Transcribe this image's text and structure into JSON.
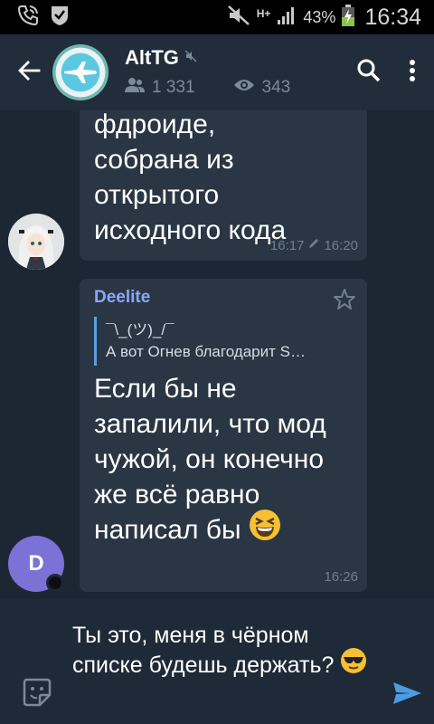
{
  "status_bar": {
    "signal_type": "H+",
    "battery_percent": "43%",
    "clock": "16:34"
  },
  "toolbar": {
    "channel_title": "AltTG",
    "subscribers": "1 331",
    "views": "343"
  },
  "messages": [
    {
      "text": "фдроиде,\nсобрана из\nоткрытого\nисходного кода",
      "time": "16:17",
      "edited_time": "16:20"
    },
    {
      "author": "Deelite",
      "reply_name": "¯\\_(ツ)_/¯",
      "reply_text": "А вот Огнев благодарит S…",
      "text": "Если бы не запалили, что мод чужой, он конечно же всё равно написал бы",
      "time": "16:26",
      "avatar_letter": "D"
    }
  ],
  "composer": {
    "input_text": "Ты это, меня в чёрном списке будешь держать?"
  },
  "colors": {
    "background": "#1d2733",
    "toolbar": "#212d3b",
    "bubble": "#2a3644",
    "author": "#8ea6f7",
    "reply_bar": "#5d9fe0",
    "avatar_purple": "#7b72d6",
    "send": "#4d9be0"
  },
  "icons": [
    "call-icon",
    "shield-icon",
    "mute-icon",
    "signal-icon",
    "battery-icon",
    "back-arrow-icon",
    "muted-speaker-icon",
    "people-icon",
    "eye-icon",
    "search-icon",
    "more-vert-icon",
    "pencil-icon",
    "star-icon",
    "sticker-icon",
    "send-icon",
    "laughing-emoji-icon",
    "sunglasses-emoji-icon"
  ]
}
